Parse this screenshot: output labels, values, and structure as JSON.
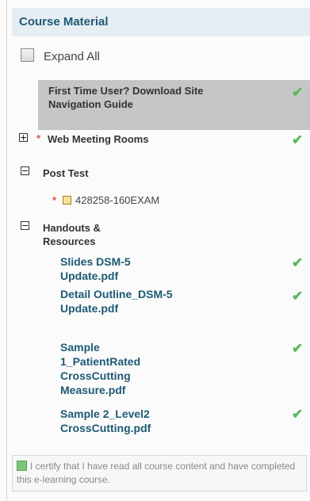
{
  "header": {
    "title": "Course Material"
  },
  "expand_all": {
    "label": "Expand All"
  },
  "items": {
    "first_time": {
      "label": "First Time User? Download Site Navigation Guide"
    },
    "web_meeting": {
      "toggle": "+",
      "required": "*",
      "label": "Web Meeting Rooms"
    },
    "post_test": {
      "toggle": "−",
      "label": "Post Test",
      "exam": {
        "required": "*",
        "label": "428258-160EXAM"
      }
    },
    "handouts": {
      "toggle": "−",
      "label": "Handouts & Resources",
      "files": [
        {
          "label": "Slides DSM-5 Update.pdf"
        },
        {
          "label": "Detail Outline_DSM-5 Update.pdf"
        },
        {
          "label": "Sample 1_PatientRated CrossCutting Measure.pdf"
        },
        {
          "label": "Sample 2_Level2 CrossCutting.pdf"
        }
      ]
    }
  },
  "check_glyph": "✔",
  "certify": {
    "text": "I certify that I have read all course content and have completed this e-learning course."
  }
}
